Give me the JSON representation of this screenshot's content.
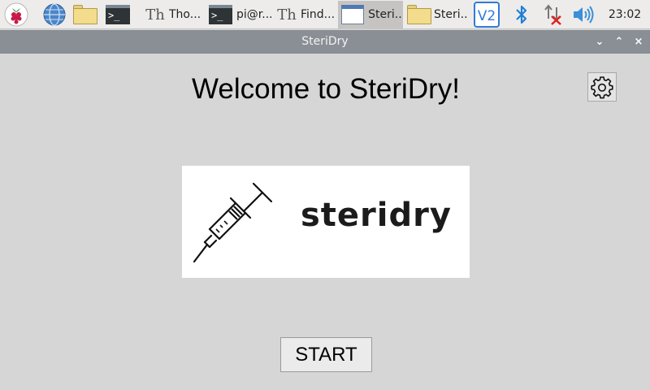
{
  "taskbar": {
    "launchers": [
      {
        "name": "raspberry-menu-icon"
      },
      {
        "name": "web-browser-icon"
      },
      {
        "name": "file-manager-icon"
      },
      {
        "name": "terminal-icon"
      }
    ],
    "tasks": [
      {
        "label": "Tho...",
        "icon": "thonny-icon",
        "active": false
      },
      {
        "label": "pi@r...",
        "icon": "terminal-icon",
        "active": false
      },
      {
        "label": "Find...",
        "icon": "thonny-icon",
        "active": false
      },
      {
        "label": "Steri...",
        "icon": "window-icon",
        "active": true
      },
      {
        "label": "Steri...",
        "icon": "folder-icon",
        "active": false
      }
    ],
    "tray": [
      "vnc-icon",
      "bluetooth-icon",
      "network-disconnected-icon",
      "volume-icon"
    ],
    "clock": "23:02",
    "terminal_glyph": ">_",
    "thonny_glyph": "Th",
    "vnc_glyph": "V2"
  },
  "window": {
    "title": "SteriDry",
    "minimize_glyph": "⌄",
    "maximize_glyph": "⌃",
    "close_glyph": "×"
  },
  "app": {
    "heading": "Welcome to SteriDry!",
    "logo_text": "steridry",
    "start_label": "START"
  },
  "colors": {
    "background": "#d6d6d6",
    "titlebar": "#898f94",
    "active_task": "#c6c4c2",
    "bluetooth": "#1d7fd6",
    "network_error": "#e02020",
    "vnc": "#2f7bd9"
  }
}
